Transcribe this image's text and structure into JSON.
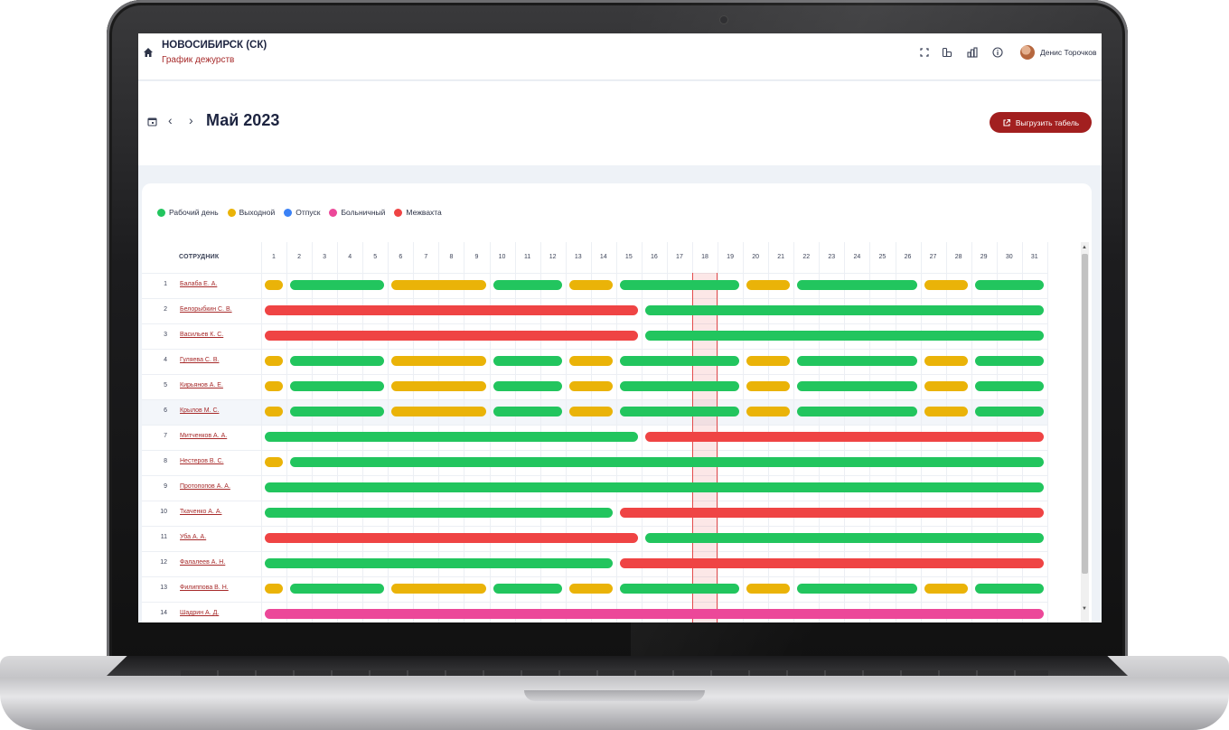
{
  "header": {
    "org_name": "НОВОСИБИРСК (СК)",
    "page_subtitle": "График дежурств",
    "user_name": "Денис Торочков",
    "icons": [
      "fullscreen-icon",
      "layout-icon",
      "chart-icon",
      "info-icon"
    ]
  },
  "toolbar": {
    "month": "Май 2023",
    "export_label": "Выгрузить табель"
  },
  "legend": [
    {
      "label": "Рабочий день",
      "color": "#22c55e"
    },
    {
      "label": "Выходной",
      "color": "#eab308"
    },
    {
      "label": "Отпуск",
      "color": "#3b82f6"
    },
    {
      "label": "Больничный",
      "color": "#ec4899"
    },
    {
      "label": "Межвахта",
      "color": "#ef4444"
    }
  ],
  "table": {
    "employee_header": "СОТРУДНИК",
    "days": [
      "1",
      "2",
      "3",
      "4",
      "5",
      "6",
      "7",
      "8",
      "9",
      "10",
      "11",
      "12",
      "13",
      "14",
      "15",
      "16",
      "17",
      "18",
      "19",
      "20",
      "21",
      "22",
      "23",
      "24",
      "25",
      "26",
      "27",
      "28",
      "29",
      "30",
      "31"
    ],
    "today": "18",
    "highlighted_row": 6,
    "colors": {
      "W": "#22c55e",
      "O": "#eab308",
      "M": "#ef4444",
      "B": "#ec4899"
    },
    "rows": [
      {
        "num": "1",
        "name": "Балаба Е. А.",
        "segments": [
          [
            "O",
            1,
            1
          ],
          [
            "W",
            2,
            5
          ],
          [
            "O",
            6,
            9
          ],
          [
            "W",
            10,
            12
          ],
          [
            "O",
            13,
            14
          ],
          [
            "W",
            15,
            19
          ],
          [
            "O",
            20,
            21
          ],
          [
            "W",
            22,
            26
          ],
          [
            "O",
            27,
            28
          ],
          [
            "W",
            29,
            31
          ]
        ]
      },
      {
        "num": "2",
        "name": "Белорыбкин С. В.",
        "segments": [
          [
            "M",
            1,
            15
          ],
          [
            "W",
            16,
            31
          ]
        ]
      },
      {
        "num": "3",
        "name": "Васильев К. С.",
        "segments": [
          [
            "M",
            1,
            15
          ],
          [
            "W",
            16,
            31
          ]
        ]
      },
      {
        "num": "4",
        "name": "Гуляева С. В.",
        "segments": [
          [
            "O",
            1,
            1
          ],
          [
            "W",
            2,
            5
          ],
          [
            "O",
            6,
            9
          ],
          [
            "W",
            10,
            12
          ],
          [
            "O",
            13,
            14
          ],
          [
            "W",
            15,
            19
          ],
          [
            "O",
            20,
            21
          ],
          [
            "W",
            22,
            26
          ],
          [
            "O",
            27,
            28
          ],
          [
            "W",
            29,
            31
          ]
        ]
      },
      {
        "num": "5",
        "name": "Кирьянов А. Е.",
        "segments": [
          [
            "O",
            1,
            1
          ],
          [
            "W",
            2,
            5
          ],
          [
            "O",
            6,
            9
          ],
          [
            "W",
            10,
            12
          ],
          [
            "O",
            13,
            14
          ],
          [
            "W",
            15,
            19
          ],
          [
            "O",
            20,
            21
          ],
          [
            "W",
            22,
            26
          ],
          [
            "O",
            27,
            28
          ],
          [
            "W",
            29,
            31
          ]
        ]
      },
      {
        "num": "6",
        "name": "Крылов М. С.",
        "segments": [
          [
            "O",
            1,
            1
          ],
          [
            "W",
            2,
            5
          ],
          [
            "O",
            6,
            9
          ],
          [
            "W",
            10,
            12
          ],
          [
            "O",
            13,
            14
          ],
          [
            "W",
            15,
            19
          ],
          [
            "O",
            20,
            21
          ],
          [
            "W",
            22,
            26
          ],
          [
            "O",
            27,
            28
          ],
          [
            "W",
            29,
            31
          ]
        ]
      },
      {
        "num": "7",
        "name": "Митченков А. А.",
        "segments": [
          [
            "W",
            1,
            15
          ],
          [
            "M",
            16,
            31
          ]
        ]
      },
      {
        "num": "8",
        "name": "Нестеров В. С.",
        "segments": [
          [
            "O",
            1,
            1
          ],
          [
            "W",
            2,
            31
          ]
        ]
      },
      {
        "num": "9",
        "name": "Протопопов А. А.",
        "segments": [
          [
            "W",
            1,
            31
          ]
        ]
      },
      {
        "num": "10",
        "name": "Ткаченко А. А.",
        "segments": [
          [
            "W",
            1,
            14
          ],
          [
            "M",
            15,
            31
          ]
        ]
      },
      {
        "num": "11",
        "name": "Уба А. А.",
        "segments": [
          [
            "M",
            1,
            15
          ],
          [
            "W",
            16,
            31
          ]
        ]
      },
      {
        "num": "12",
        "name": "Фалалеев А. Н.",
        "segments": [
          [
            "W",
            1,
            14
          ],
          [
            "M",
            15,
            31
          ]
        ]
      },
      {
        "num": "13",
        "name": "Филиппова В. Н.",
        "segments": [
          [
            "O",
            1,
            1
          ],
          [
            "W",
            2,
            5
          ],
          [
            "O",
            6,
            9
          ],
          [
            "W",
            10,
            12
          ],
          [
            "O",
            13,
            14
          ],
          [
            "W",
            15,
            19
          ],
          [
            "O",
            20,
            21
          ],
          [
            "W",
            22,
            26
          ],
          [
            "O",
            27,
            28
          ],
          [
            "W",
            29,
            31
          ]
        ]
      },
      {
        "num": "14",
        "name": "Шадрин А. Д.",
        "segments": [
          [
            "B",
            1,
            31
          ]
        ]
      }
    ]
  }
}
